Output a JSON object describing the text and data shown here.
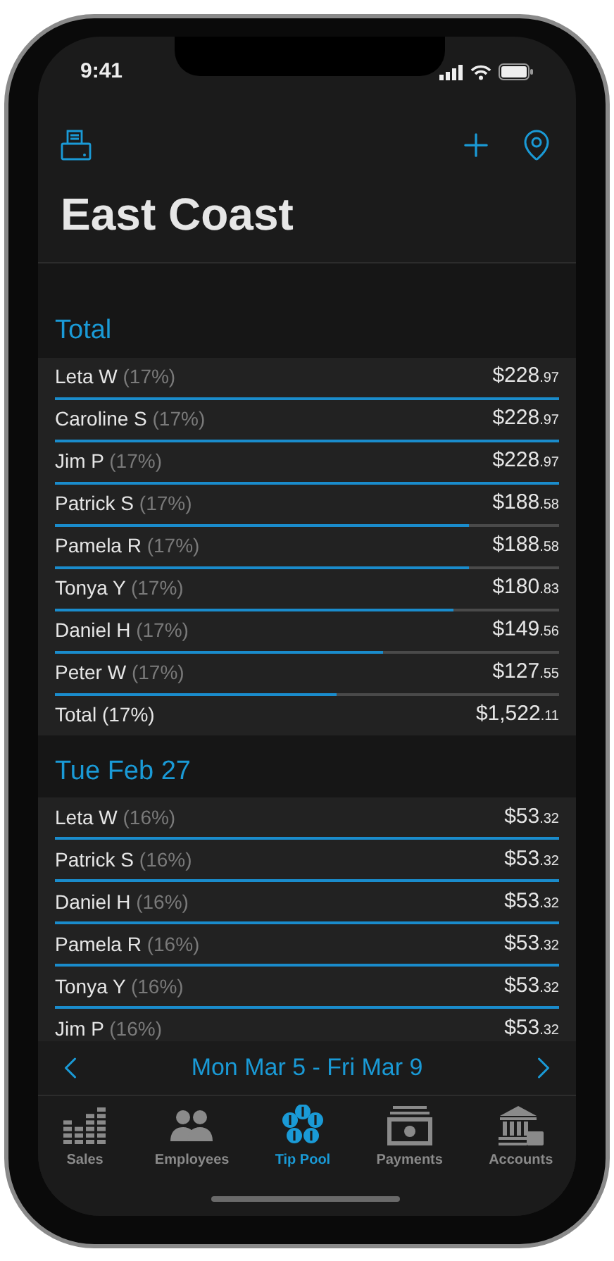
{
  "status_bar": {
    "time": "9:41"
  },
  "title": "East Coast",
  "sections": [
    {
      "heading": "Total",
      "rows": [
        {
          "name": "Leta W",
          "share": "(17%)",
          "amount": "$228",
          "cents": ".97",
          "level": 1
        },
        {
          "name": "Caroline S",
          "share": "(17%)",
          "amount": "$228",
          "cents": ".97",
          "level": 1
        },
        {
          "name": "Jim P",
          "share": "(17%)",
          "amount": "$228",
          "cents": ".97",
          "level": 1
        },
        {
          "name": "Patrick S",
          "share": "(17%)",
          "amount": "$188",
          "cents": ".58",
          "level": 0.82
        },
        {
          "name": "Pamela R",
          "share": "(17%)",
          "amount": "$188",
          "cents": ".58",
          "level": 0.82
        },
        {
          "name": "Tonya Y",
          "share": "(17%)",
          "amount": "$180",
          "cents": ".83",
          "level": 0.79
        },
        {
          "name": "Daniel H",
          "share": "(17%)",
          "amount": "$149",
          "cents": ".56",
          "level": 0.65
        },
        {
          "name": "Peter W",
          "share": "(17%)",
          "amount": "$127",
          "cents": ".55",
          "level": 0.56
        }
      ],
      "total": {
        "label": "Total (17%)",
        "amount": "$1,522",
        "cents": ".11"
      }
    },
    {
      "heading": "Tue Feb 27",
      "rows": [
        {
          "name": "Leta W",
          "share": "(16%)",
          "amount": "$53",
          "cents": ".32",
          "level": 1
        },
        {
          "name": "Patrick S",
          "share": "(16%)",
          "amount": "$53",
          "cents": ".32",
          "level": 1
        },
        {
          "name": "Daniel H",
          "share": "(16%)",
          "amount": "$53",
          "cents": ".32",
          "level": 1
        },
        {
          "name": "Pamela R",
          "share": "(16%)",
          "amount": "$53",
          "cents": ".32",
          "level": 1
        },
        {
          "name": "Tonya Y",
          "share": "(16%)",
          "amount": "$53",
          "cents": ".32",
          "level": 1
        },
        {
          "name": "Jim P",
          "share": "(16%)",
          "amount": "$53",
          "cents": ".32"
        }
      ]
    }
  ],
  "date_range": {
    "label": "Mon Mar 5 - Fri Mar 9"
  },
  "tabs": [
    {
      "kind": "sales",
      "label": "Sales",
      "selected": false
    },
    {
      "kind": "employees",
      "label": "Employees",
      "selected": false
    },
    {
      "kind": "tips",
      "label": "Tip Pool",
      "selected": true
    },
    {
      "kind": "payments",
      "label": "Payments",
      "selected": false
    },
    {
      "kind": "accounts",
      "label": "Accounts",
      "selected": false
    }
  ]
}
